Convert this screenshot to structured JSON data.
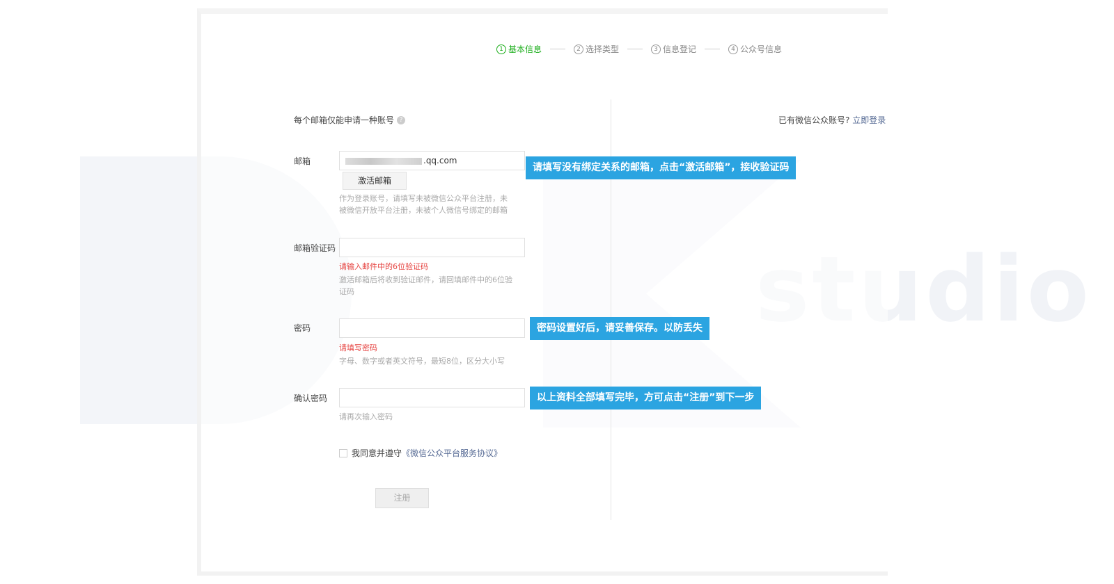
{
  "steps": [
    {
      "num": "1",
      "label": "基本信息",
      "active": true
    },
    {
      "num": "2",
      "label": "选择类型",
      "active": false
    },
    {
      "num": "3",
      "label": "信息登记",
      "active": false
    },
    {
      "num": "4",
      "label": "公众号信息",
      "active": false
    }
  ],
  "header": {
    "note": "每个邮箱仅能申请一种账号",
    "login_prompt": "已有微信公众账号?",
    "login_link": "立即登录"
  },
  "form": {
    "email": {
      "label": "邮箱",
      "value": ".qq.com",
      "activate_button": "激活邮箱",
      "hint": "作为登录账号，请填写未被微信公众平台注册，未被微信开放平台注册，未被个人微信号绑定的邮箱"
    },
    "code": {
      "label": "邮箱验证码",
      "error": "请输入邮件中的6位验证码",
      "hint": "激活邮箱后将收到验证邮件，请回填邮件中的6位验证码"
    },
    "password": {
      "label": "密码",
      "error": "请填写密码",
      "hint": "字母、数字或者英文符号，最短8位，区分大小写"
    },
    "confirm": {
      "label": "确认密码",
      "hint": "请再次输入密码"
    },
    "agree": {
      "text": "我同意并遵守",
      "link": "《微信公众平台服务协议》"
    },
    "register_button": "注册"
  },
  "callouts": {
    "email": "请填写没有绑定关系的邮箱，点击“激活邮箱”，接收验证码",
    "password": "密码设置好后，请妥善保存。以防丢失",
    "submit": "以上资料全部填写完毕，方可点击“注册”到下一步"
  },
  "watermark": "studio",
  "colors": {
    "active": "#1aad19",
    "link": "#576b95",
    "error": "#e64340",
    "callout": "#2ba4e1"
  }
}
